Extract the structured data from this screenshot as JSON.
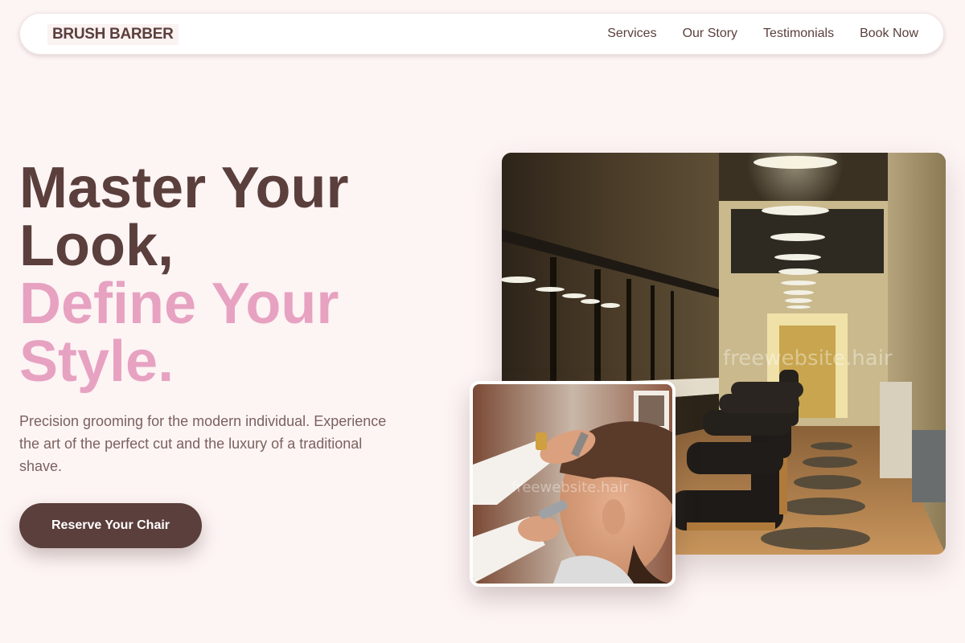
{
  "nav": {
    "brand": "BRUSH BARBER",
    "links": [
      "Services",
      "Our Story",
      "Testimonials",
      "Book Now"
    ]
  },
  "hero": {
    "title_lines": [
      "Master Your",
      "Look,"
    ],
    "accent_lines": [
      "Define Your",
      "Style."
    ],
    "description": "Precision grooming for the modern individual. Experience the art of the perfect cut and the luxury of a traditional shave.",
    "cta_label": "Reserve Your Chair"
  },
  "images": {
    "main_photo": {
      "watermark": "freewebsite.hair"
    },
    "small_photo": {
      "watermark": "freewebsite.hair"
    }
  },
  "colors": {
    "background": "#fdf4f4",
    "brand_brown": "#5a3f3c",
    "accent_pink": "#e7a2c1",
    "body_text": "#7b625f"
  }
}
